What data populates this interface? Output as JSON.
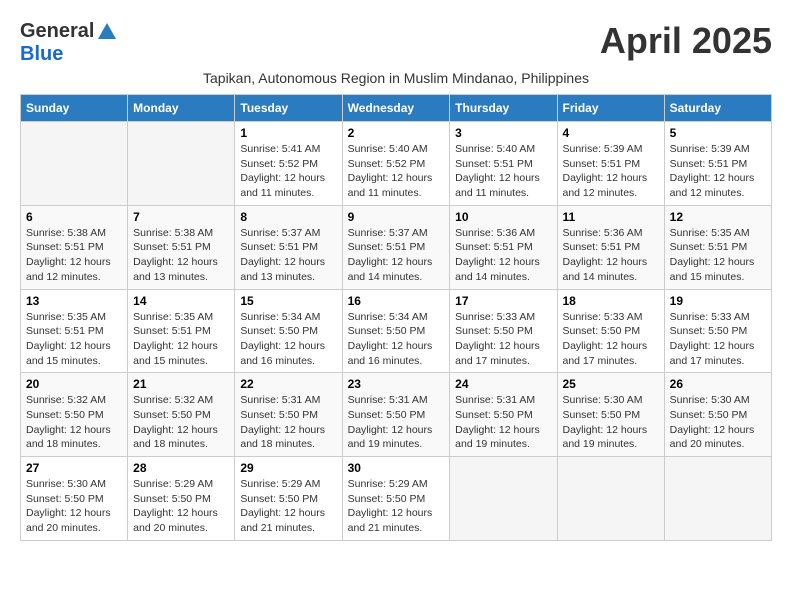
{
  "header": {
    "logo_general": "General",
    "logo_blue": "Blue",
    "month_title": "April 2025",
    "subtitle": "Tapikan, Autonomous Region in Muslim Mindanao, Philippines"
  },
  "weekdays": [
    "Sunday",
    "Monday",
    "Tuesday",
    "Wednesday",
    "Thursday",
    "Friday",
    "Saturday"
  ],
  "weeks": [
    [
      {
        "day": "",
        "sunrise": "",
        "sunset": "",
        "daylight": ""
      },
      {
        "day": "",
        "sunrise": "",
        "sunset": "",
        "daylight": ""
      },
      {
        "day": "1",
        "sunrise": "Sunrise: 5:41 AM",
        "sunset": "Sunset: 5:52 PM",
        "daylight": "Daylight: 12 hours and 11 minutes."
      },
      {
        "day": "2",
        "sunrise": "Sunrise: 5:40 AM",
        "sunset": "Sunset: 5:52 PM",
        "daylight": "Daylight: 12 hours and 11 minutes."
      },
      {
        "day": "3",
        "sunrise": "Sunrise: 5:40 AM",
        "sunset": "Sunset: 5:51 PM",
        "daylight": "Daylight: 12 hours and 11 minutes."
      },
      {
        "day": "4",
        "sunrise": "Sunrise: 5:39 AM",
        "sunset": "Sunset: 5:51 PM",
        "daylight": "Daylight: 12 hours and 12 minutes."
      },
      {
        "day": "5",
        "sunrise": "Sunrise: 5:39 AM",
        "sunset": "Sunset: 5:51 PM",
        "daylight": "Daylight: 12 hours and 12 minutes."
      }
    ],
    [
      {
        "day": "6",
        "sunrise": "Sunrise: 5:38 AM",
        "sunset": "Sunset: 5:51 PM",
        "daylight": "Daylight: 12 hours and 12 minutes."
      },
      {
        "day": "7",
        "sunrise": "Sunrise: 5:38 AM",
        "sunset": "Sunset: 5:51 PM",
        "daylight": "Daylight: 12 hours and 13 minutes."
      },
      {
        "day": "8",
        "sunrise": "Sunrise: 5:37 AM",
        "sunset": "Sunset: 5:51 PM",
        "daylight": "Daylight: 12 hours and 13 minutes."
      },
      {
        "day": "9",
        "sunrise": "Sunrise: 5:37 AM",
        "sunset": "Sunset: 5:51 PM",
        "daylight": "Daylight: 12 hours and 14 minutes."
      },
      {
        "day": "10",
        "sunrise": "Sunrise: 5:36 AM",
        "sunset": "Sunset: 5:51 PM",
        "daylight": "Daylight: 12 hours and 14 minutes."
      },
      {
        "day": "11",
        "sunrise": "Sunrise: 5:36 AM",
        "sunset": "Sunset: 5:51 PM",
        "daylight": "Daylight: 12 hours and 14 minutes."
      },
      {
        "day": "12",
        "sunrise": "Sunrise: 5:35 AM",
        "sunset": "Sunset: 5:51 PM",
        "daylight": "Daylight: 12 hours and 15 minutes."
      }
    ],
    [
      {
        "day": "13",
        "sunrise": "Sunrise: 5:35 AM",
        "sunset": "Sunset: 5:51 PM",
        "daylight": "Daylight: 12 hours and 15 minutes."
      },
      {
        "day": "14",
        "sunrise": "Sunrise: 5:35 AM",
        "sunset": "Sunset: 5:51 PM",
        "daylight": "Daylight: 12 hours and 15 minutes."
      },
      {
        "day": "15",
        "sunrise": "Sunrise: 5:34 AM",
        "sunset": "Sunset: 5:50 PM",
        "daylight": "Daylight: 12 hours and 16 minutes."
      },
      {
        "day": "16",
        "sunrise": "Sunrise: 5:34 AM",
        "sunset": "Sunset: 5:50 PM",
        "daylight": "Daylight: 12 hours and 16 minutes."
      },
      {
        "day": "17",
        "sunrise": "Sunrise: 5:33 AM",
        "sunset": "Sunset: 5:50 PM",
        "daylight": "Daylight: 12 hours and 17 minutes."
      },
      {
        "day": "18",
        "sunrise": "Sunrise: 5:33 AM",
        "sunset": "Sunset: 5:50 PM",
        "daylight": "Daylight: 12 hours and 17 minutes."
      },
      {
        "day": "19",
        "sunrise": "Sunrise: 5:33 AM",
        "sunset": "Sunset: 5:50 PM",
        "daylight": "Daylight: 12 hours and 17 minutes."
      }
    ],
    [
      {
        "day": "20",
        "sunrise": "Sunrise: 5:32 AM",
        "sunset": "Sunset: 5:50 PM",
        "daylight": "Daylight: 12 hours and 18 minutes."
      },
      {
        "day": "21",
        "sunrise": "Sunrise: 5:32 AM",
        "sunset": "Sunset: 5:50 PM",
        "daylight": "Daylight: 12 hours and 18 minutes."
      },
      {
        "day": "22",
        "sunrise": "Sunrise: 5:31 AM",
        "sunset": "Sunset: 5:50 PM",
        "daylight": "Daylight: 12 hours and 18 minutes."
      },
      {
        "day": "23",
        "sunrise": "Sunrise: 5:31 AM",
        "sunset": "Sunset: 5:50 PM",
        "daylight": "Daylight: 12 hours and 19 minutes."
      },
      {
        "day": "24",
        "sunrise": "Sunrise: 5:31 AM",
        "sunset": "Sunset: 5:50 PM",
        "daylight": "Daylight: 12 hours and 19 minutes."
      },
      {
        "day": "25",
        "sunrise": "Sunrise: 5:30 AM",
        "sunset": "Sunset: 5:50 PM",
        "daylight": "Daylight: 12 hours and 19 minutes."
      },
      {
        "day": "26",
        "sunrise": "Sunrise: 5:30 AM",
        "sunset": "Sunset: 5:50 PM",
        "daylight": "Daylight: 12 hours and 20 minutes."
      }
    ],
    [
      {
        "day": "27",
        "sunrise": "Sunrise: 5:30 AM",
        "sunset": "Sunset: 5:50 PM",
        "daylight": "Daylight: 12 hours and 20 minutes."
      },
      {
        "day": "28",
        "sunrise": "Sunrise: 5:29 AM",
        "sunset": "Sunset: 5:50 PM",
        "daylight": "Daylight: 12 hours and 20 minutes."
      },
      {
        "day": "29",
        "sunrise": "Sunrise: 5:29 AM",
        "sunset": "Sunset: 5:50 PM",
        "daylight": "Daylight: 12 hours and 21 minutes."
      },
      {
        "day": "30",
        "sunrise": "Sunrise: 5:29 AM",
        "sunset": "Sunset: 5:50 PM",
        "daylight": "Daylight: 12 hours and 21 minutes."
      },
      {
        "day": "",
        "sunrise": "",
        "sunset": "",
        "daylight": ""
      },
      {
        "day": "",
        "sunrise": "",
        "sunset": "",
        "daylight": ""
      },
      {
        "day": "",
        "sunrise": "",
        "sunset": "",
        "daylight": ""
      }
    ]
  ]
}
